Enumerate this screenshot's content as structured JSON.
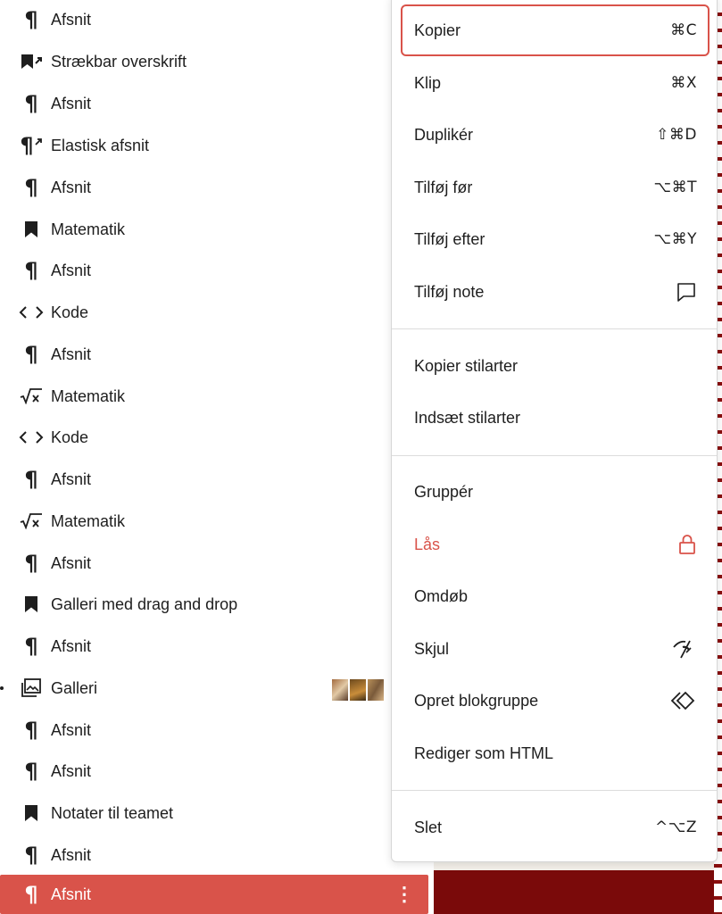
{
  "list_view": {
    "rows": [
      {
        "label": "Afsnit",
        "icon": "paragraph-icon"
      },
      {
        "label": "Strækbar overskrift",
        "icon": "stretchy-heading-icon"
      },
      {
        "label": "Afsnit",
        "icon": "paragraph-icon"
      },
      {
        "label": "Elastisk afsnit",
        "icon": "stretchy-paragraph-icon"
      },
      {
        "label": "Afsnit",
        "icon": "paragraph-icon"
      },
      {
        "label": "Matematik",
        "icon": "bookmark-icon"
      },
      {
        "label": "Afsnit",
        "icon": "paragraph-icon"
      },
      {
        "label": "Kode",
        "icon": "code-icon"
      },
      {
        "label": "Afsnit",
        "icon": "paragraph-icon"
      },
      {
        "label": "Matematik",
        "icon": "math-icon"
      },
      {
        "label": "Kode",
        "icon": "code-icon"
      },
      {
        "label": "Afsnit",
        "icon": "paragraph-icon"
      },
      {
        "label": "Matematik",
        "icon": "math-icon"
      },
      {
        "label": "Afsnit",
        "icon": "paragraph-icon"
      },
      {
        "label": "Galleri med drag and drop",
        "icon": "bookmark-icon"
      },
      {
        "label": "Afsnit",
        "icon": "paragraph-icon"
      },
      {
        "label": "Galleri",
        "icon": "gallery-icon"
      },
      {
        "label": "Afsnit",
        "icon": "paragraph-icon"
      },
      {
        "label": "Afsnit",
        "icon": "paragraph-icon"
      },
      {
        "label": "Notater til teamet",
        "icon": "bookmark-icon"
      },
      {
        "label": "Afsnit",
        "icon": "paragraph-icon"
      },
      {
        "label": "Afsnit",
        "icon": "paragraph-icon",
        "selected": true
      }
    ]
  },
  "menu": {
    "group1": {
      "copy": {
        "label": "Kopier",
        "shortcut": "⌘C"
      },
      "cut": {
        "label": "Klip",
        "shortcut": "⌘X"
      },
      "duplicate": {
        "label": "Duplikér",
        "shortcut": "⇧⌘D"
      },
      "insert_before": {
        "label": "Tilføj før",
        "shortcut": "⌥⌘T"
      },
      "insert_after": {
        "label": "Tilføj efter",
        "shortcut": "⌥⌘Y"
      },
      "add_note": {
        "label": "Tilføj note",
        "icon": "comment-icon"
      }
    },
    "group2": {
      "copy_styles": {
        "label": "Kopier stilarter"
      },
      "paste_styles": {
        "label": "Indsæt stilarter"
      }
    },
    "group3": {
      "group": {
        "label": "Gruppér"
      },
      "lock": {
        "label": "Lås",
        "icon": "lock-icon"
      },
      "rename": {
        "label": "Omdøb"
      },
      "hide": {
        "label": "Skjul",
        "icon": "eye-hidden-icon"
      },
      "create_pattern": {
        "label": "Opret blokgruppe",
        "icon": "symbol-icon"
      },
      "edit_html": {
        "label": "Rediger som HTML"
      }
    },
    "group4": {
      "delete": {
        "label": "Slet",
        "shortcut": "^⌥Z"
      }
    }
  },
  "colors": {
    "accent": "#d9534a",
    "canvas_dark": "#7a0a0a"
  }
}
